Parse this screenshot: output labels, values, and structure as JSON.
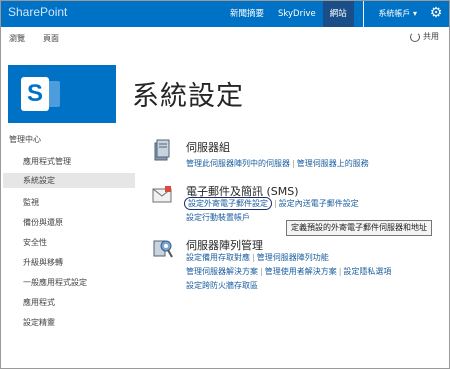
{
  "suite_bar": {
    "brand": "SharePoint",
    "nav": [
      "新聞摘要",
      "SkyDrive",
      "網站"
    ],
    "active_nav_index": 2,
    "account": "系統帳戶 ▾",
    "settings_icon": "gear-icon",
    "color": "#0072c6"
  },
  "ribbon": {
    "browse": "瀏覽",
    "page": "頁面",
    "share": "共用",
    "share_icon": "share-icon"
  },
  "page": {
    "title": "系統設定",
    "logo_icon": "sharepoint-logo"
  },
  "left_nav": {
    "heading": "管理中心",
    "items": [
      "應用程式管理",
      "系統設定",
      "監視",
      "備份與還原",
      "安全性",
      "升級與移轉",
      "一般應用程式設定",
      "應用程式",
      "設定精靈"
    ],
    "selected_index": 1
  },
  "groups": {
    "servers": {
      "title": "伺服器組",
      "links": [
        "管理此伺服器陣列中的伺服器",
        "管理伺服器上的服務"
      ]
    },
    "email": {
      "title": "電子郵件及簡訊 (SMS)",
      "links": [
        "設定外寄電子郵件設定",
        "設定內送電子郵件設定",
        "設定行動裝置帳戶"
      ],
      "tooltip": "定義預設的外寄電子郵件伺服器和地址"
    },
    "farm": {
      "title": "伺服器陣列管理",
      "links": [
        "設定備用存取對應",
        "管理伺服器陣列功能",
        "管理伺服器解決方案",
        "管理使用者解決方案",
        "設定隱私選項",
        "設定跨防火牆存取區"
      ]
    }
  }
}
